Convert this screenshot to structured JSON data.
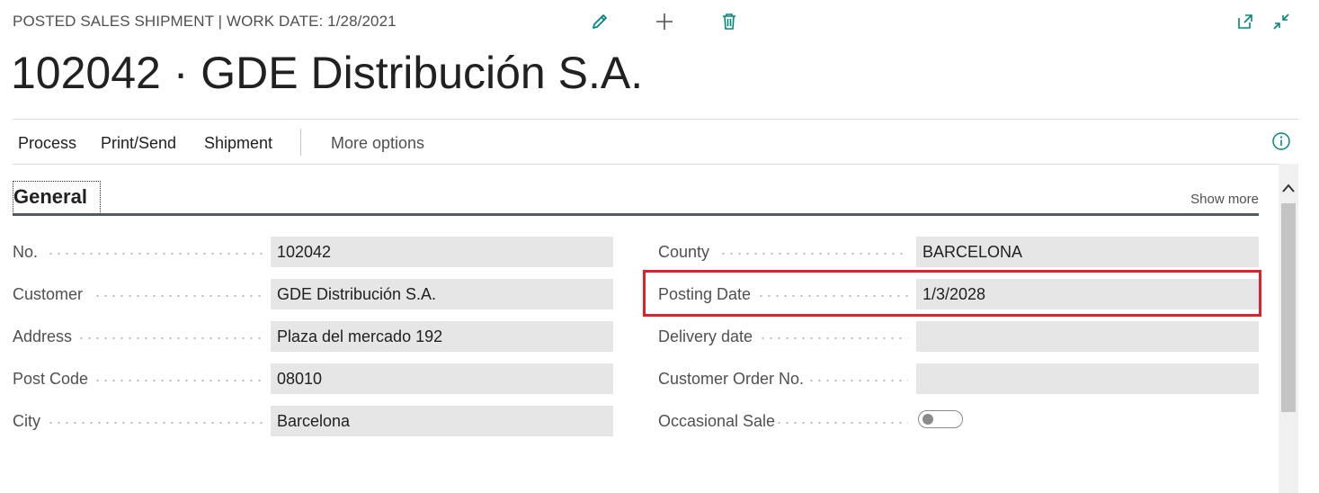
{
  "header": {
    "caption": "POSTED SALES SHIPMENT | WORK DATE: 1/28/2021",
    "title": "102042 · GDE Distribución S.A.",
    "icons": [
      "edit-icon",
      "add-icon",
      "delete-icon",
      "open-new-window-icon",
      "collapse-icon"
    ]
  },
  "actions": {
    "items": [
      "Process",
      "Print/Send",
      "Shipment"
    ],
    "more": "More options"
  },
  "section": {
    "title": "General",
    "show_more": "Show more"
  },
  "left_fields": [
    {
      "label": "No.",
      "value": "102042"
    },
    {
      "label": "Customer",
      "value": "GDE Distribución S.A."
    },
    {
      "label": "Address",
      "value": "Plaza del mercado 192"
    },
    {
      "label": "Post Code",
      "value": "08010"
    },
    {
      "label": "City",
      "value": "Barcelona"
    }
  ],
  "right_fields": [
    {
      "label": "County",
      "value": "BARCELONA"
    },
    {
      "label": "Posting Date",
      "value": "1/3/2028"
    },
    {
      "label": "Delivery date",
      "value": ""
    },
    {
      "label": "Customer Order No.",
      "value": ""
    },
    {
      "label": "Occasional Sale",
      "toggle": false
    }
  ],
  "colors": {
    "accent": "#00897b",
    "highlight": "#e0202a"
  }
}
